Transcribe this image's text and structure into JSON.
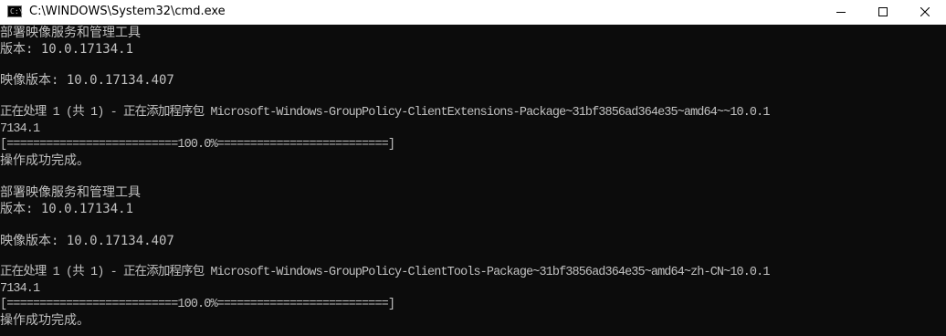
{
  "window": {
    "title": "C:\\WINDOWS\\System32\\cmd.exe",
    "icon_text": "C:\\"
  },
  "console": {
    "lines": [
      "部署映像服务和管理工具",
      "版本: 10.0.17134.1",
      "",
      "映像版本: 10.0.17134.407",
      "",
      "正在处理 1 (共 1) - 正在添加程序包 Microsoft-Windows-GroupPolicy-ClientExtensions-Package~31bf3856ad364e35~amd64~~10.0.1",
      "7134.1",
      "[==========================100.0%==========================]",
      "操作成功完成。",
      "",
      "部署映像服务和管理工具",
      "版本: 10.0.17134.1",
      "",
      "映像版本: 10.0.17134.407",
      "",
      "正在处理 1 (共 1) - 正在添加程序包 Microsoft-Windows-GroupPolicy-ClientTools-Package~31bf3856ad364e35~amd64~zh-CN~10.0.1",
      "7134.1",
      "[==========================100.0%==========================]",
      "操作成功完成。"
    ]
  }
}
